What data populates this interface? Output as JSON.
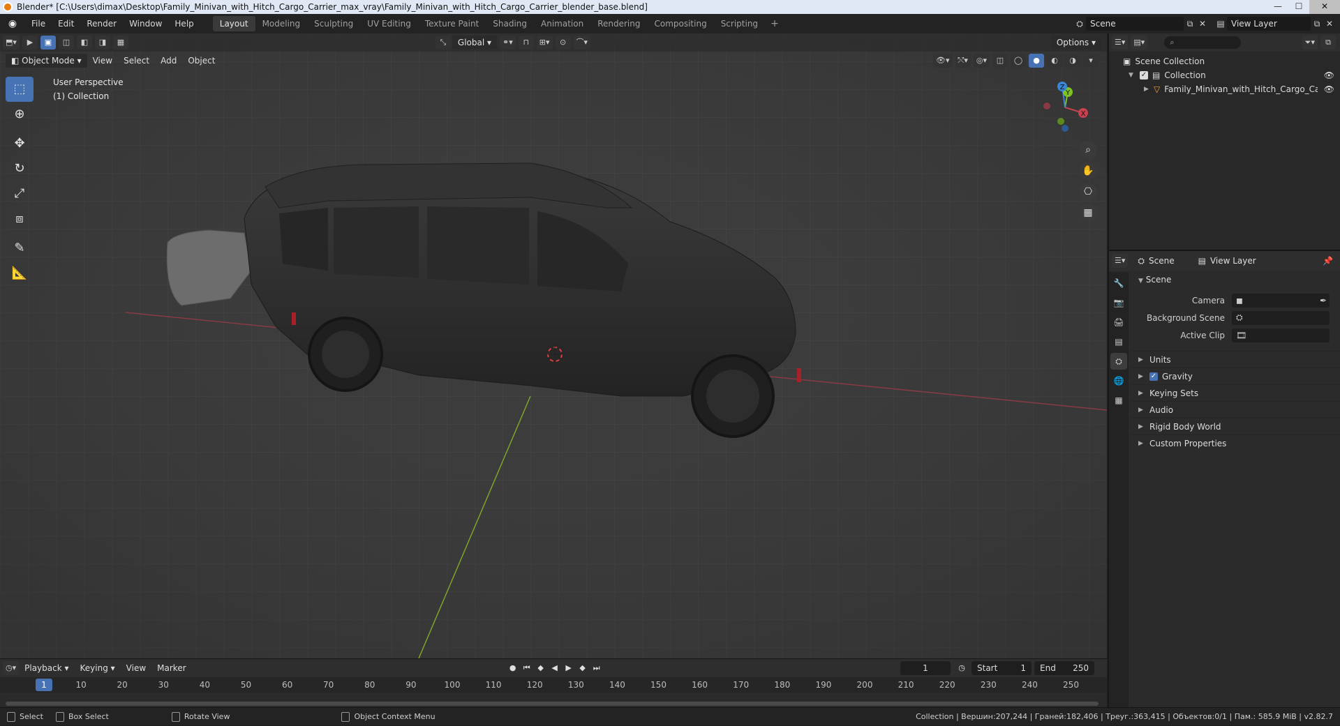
{
  "window": {
    "title": "Blender* [C:\\Users\\dimax\\Desktop\\Family_Minivan_with_Hitch_Cargo_Carrier_max_vray\\Family_Minivan_with_Hitch_Cargo_Carrier_blender_base.blend]",
    "min": "—",
    "max": "☐",
    "close": "✕"
  },
  "menubar": {
    "items": [
      "File",
      "Edit",
      "Render",
      "Window",
      "Help"
    ]
  },
  "workspaces": {
    "tabs": [
      "Layout",
      "Modeling",
      "Sculpting",
      "UV Editing",
      "Texture Paint",
      "Shading",
      "Animation",
      "Rendering",
      "Compositing",
      "Scripting"
    ],
    "add": "+"
  },
  "topright": {
    "scene": "Scene",
    "view_layer": "View Layer"
  },
  "viewport": {
    "mode": "Object Mode",
    "menus": [
      "View",
      "Select",
      "Add",
      "Object"
    ],
    "transform": "Global",
    "options": "Options",
    "overlay_line1": "User Perspective",
    "overlay_line2": "(1) Collection",
    "gizmo": {
      "x": "X",
      "y": "Y",
      "z": "Z"
    }
  },
  "timeline": {
    "menus": [
      "Playback",
      "Keying",
      "View",
      "Marker"
    ],
    "current_frame": "1",
    "start_label": "Start",
    "start": "1",
    "end_label": "End",
    "end": "250",
    "ruler": [
      "1",
      "10",
      "20",
      "30",
      "40",
      "50",
      "60",
      "70",
      "80",
      "90",
      "100",
      "110",
      "120",
      "130",
      "140",
      "150",
      "160",
      "170",
      "180",
      "190",
      "200",
      "210",
      "220",
      "230",
      "240",
      "250"
    ]
  },
  "statusbar": {
    "select": "Select",
    "box_select": "Box Select",
    "rotate_view": "Rotate View",
    "context_menu": "Object Context Menu",
    "stats": "Collection | Вершин:207,244 | Граней:182,406 | Треуг.:363,415 | Объектов:0/1 | Пам.: 585.9 MiB | v2.82.7"
  },
  "outliner": {
    "search_placeholder": "",
    "scene_collection": "Scene Collection",
    "collection": "Collection",
    "object": "Family_Minivan_with_Hitch_Cargo_Carrier_c"
  },
  "properties": {
    "header_scene": "Scene",
    "header_view_layer": "View Layer",
    "panel_title": "Scene",
    "camera_label": "Camera",
    "background_scene_label": "Background Scene",
    "active_clip_label": "Active Clip",
    "subpanels": [
      "Units",
      "Gravity",
      "Keying Sets",
      "Audio",
      "Rigid Body World",
      "Custom Properties"
    ]
  },
  "colors": {
    "accent": "#4772b3",
    "x_axis": "#c8424f",
    "y_axis": "#7ec225",
    "z_axis": "#3a86d8"
  }
}
